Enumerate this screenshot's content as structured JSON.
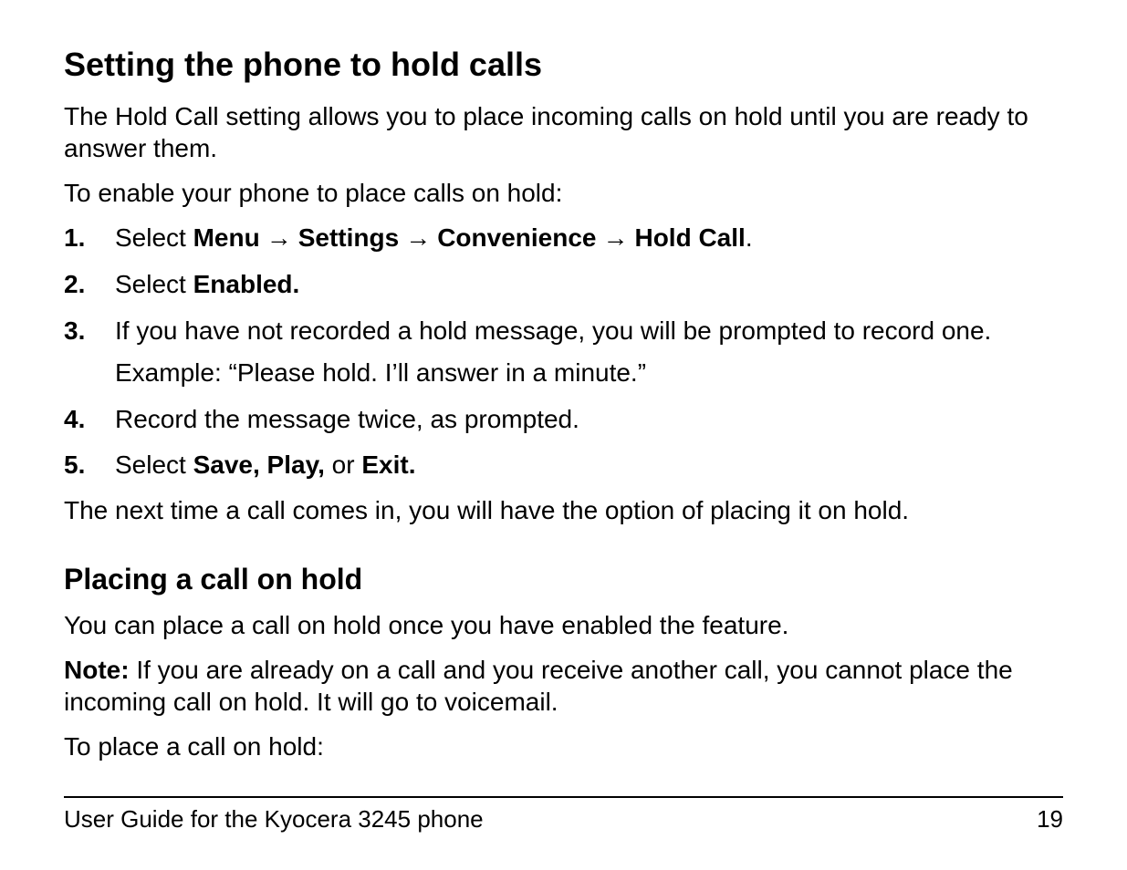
{
  "section1": {
    "heading": "Setting the phone to hold calls",
    "intro": "The Hold Call setting allows you to place incoming calls on hold until you are ready to answer them.",
    "lead": "To enable your phone to place calls on hold:",
    "steps": {
      "s1_num": "1.",
      "s1_pre": "Select ",
      "s1_menu": "Menu",
      "s1_settings": "Settings",
      "s1_conv": "Convenience",
      "s1_hold": "Hold Call",
      "s1_period": ".",
      "arrow": " → ",
      "s2_num": "2.",
      "s2_pre": "Select ",
      "s2_bold": "Enabled.",
      "s3_num": "3.",
      "s3_text": "If you have not recorded a hold message, you will be prompted to record one.",
      "s3_example": "Example: “Please hold. I’ll answer in a minute.”",
      "s4_num": "4.",
      "s4_text": "Record the message twice, as prompted.",
      "s5_num": "5.",
      "s5_pre": "Select ",
      "s5_b1": "Save, Play,",
      "s5_mid": " or ",
      "s5_b2": "Exit."
    },
    "after": "The next time a call comes in, you will have the option of placing it on hold."
  },
  "section2": {
    "heading": "Placing a call on hold",
    "p1": "You can place a call on hold once you have enabled the feature.",
    "note_label": "Note: ",
    "note_text": "If you are already on a call and you receive another call, you cannot place the incoming call on hold. It will go to voicemail.",
    "p3": "To place a call on hold:"
  },
  "footer": {
    "title": "User Guide for the Kyocera 3245 phone",
    "page": "19"
  }
}
